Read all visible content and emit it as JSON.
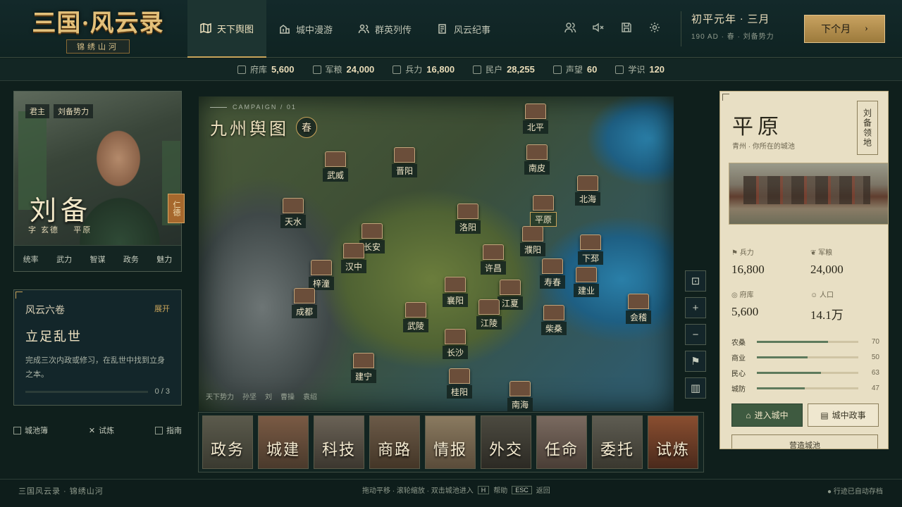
{
  "logo": {
    "title": "三国·风云录",
    "subtitle": "锦绣山河"
  },
  "nav": [
    {
      "label": "天下舆图",
      "active": true
    },
    {
      "label": "城中漫游",
      "active": false
    },
    {
      "label": "群英列传",
      "active": false
    },
    {
      "label": "风云纪事",
      "active": false
    }
  ],
  "top_icons": [
    "people-icon",
    "mute-icon",
    "save-icon",
    "settings-icon"
  ],
  "date": {
    "main": "初平元年 · 三月",
    "sub": "190 AD · 春 · 刘备势力"
  },
  "next_button": {
    "label": "下个月",
    "icon": "chevron-right-icon"
  },
  "resources": [
    {
      "label": "府库",
      "value": "5,600"
    },
    {
      "label": "军粮",
      "value": "24,000"
    },
    {
      "label": "兵力",
      "value": "16,800"
    },
    {
      "label": "民户",
      "value": "28,255"
    },
    {
      "label": "声望",
      "value": "60"
    },
    {
      "label": "学识",
      "value": "120"
    }
  ],
  "hero": {
    "tag_role": "君主",
    "tag_faction": "刘备势力",
    "name": "刘备",
    "courtesy": "字 玄德",
    "location": "平原",
    "trait": "仁德",
    "stats": [
      "统率",
      "武力",
      "智谋",
      "政务",
      "魅力"
    ]
  },
  "quest": {
    "chapter": "风云六卷",
    "expand": "展开",
    "title": "立足乱世",
    "desc": "完成三次内政或修习，在乱世中找到立身之本。",
    "progress_text": "0 / 3",
    "progress": 0
  },
  "left_links": [
    "城池簿",
    "试炼",
    "指南"
  ],
  "map": {
    "kicker": "CAMPAIGN / 01",
    "title": "九州舆图",
    "season": "春",
    "cities": [
      "北平",
      "南皮",
      "武威",
      "晋阳",
      "北海",
      "天水",
      "平原",
      "长安",
      "洛阳",
      "濮阳",
      "汉中",
      "许昌",
      "下邳",
      "梓潼",
      "寿春",
      "建业",
      "成都",
      "襄阳",
      "江夏",
      "会稽",
      "武陵",
      "江陵",
      "柴桑",
      "长沙",
      "建宁",
      "桂阳",
      "南海"
    ],
    "legend": [
      "天下势力",
      "孙坚",
      "刘",
      "曹操",
      "袁绍"
    ]
  },
  "map_tools": [
    "locate-icon",
    "zoom-in-icon",
    "zoom-out-icon",
    "flag-icon",
    "map-icon"
  ],
  "actions": [
    "政务",
    "城建",
    "科技",
    "商路",
    "情报",
    "外交",
    "任命",
    "委托",
    "试炼"
  ],
  "city_panel": {
    "name": "平原",
    "sub": "青州 · 你所在的城池",
    "seal": "刘备领地",
    "stats": [
      {
        "label": "兵力",
        "value": "16,800"
      },
      {
        "label": "军粮",
        "value": "24,000"
      },
      {
        "label": "府库",
        "value": "5,600"
      },
      {
        "label": "人口",
        "value": "14.1万"
      }
    ],
    "development": [
      {
        "label": "农桑",
        "value": 70
      },
      {
        "label": "商业",
        "value": 50
      },
      {
        "label": "民心",
        "value": 63
      },
      {
        "label": "城防",
        "value": 47
      }
    ],
    "enter_button": "进入城中",
    "affairs_button": "城中政事",
    "build_button": "营造城池"
  },
  "footer": {
    "left": "三国风云录 · 锦绣山河",
    "hint": "拖动平移 · 滚轮缩放 · 双击城池进入",
    "help_key": "H",
    "help_label": "帮助",
    "back_key": "ESC",
    "back_label": "返回",
    "right": "● 行迹已自动存档"
  }
}
